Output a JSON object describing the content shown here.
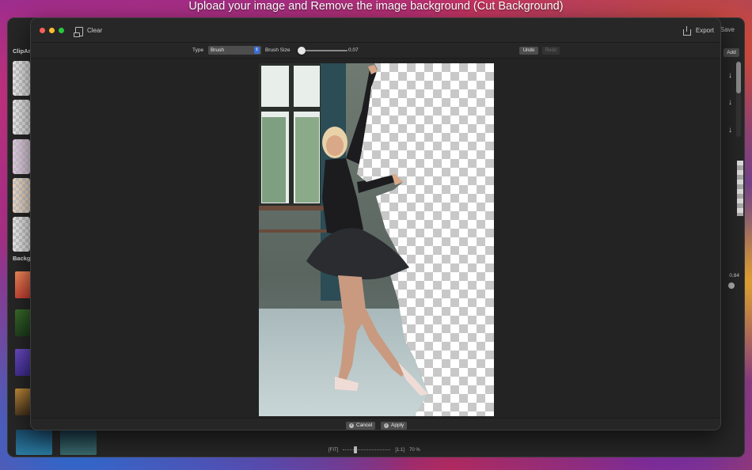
{
  "headline": "Upload your image and Remove the image background (Cut Background)",
  "background_window": {
    "sections": {
      "clipart_label": "ClipArt",
      "background_label": "Backgr"
    },
    "right_panel": {
      "save_label": "Save",
      "add_label": "Add",
      "value_label": "0.84"
    },
    "zoom": {
      "fit_label": "[FIT]",
      "one_to_one_label": "[1:1]",
      "percent_label": "70 %"
    }
  },
  "modal": {
    "titlebar": {
      "clear_label": "Clear",
      "export_label": "Export"
    },
    "toolbar": {
      "type_label": "Type",
      "type_value": "Brush",
      "brush_size_label": "Brush Size",
      "brush_size_value": "0.07",
      "brush_size_fraction": 0.07,
      "undo_label": "Undo",
      "redo_label": "Redo"
    },
    "footer": {
      "cancel_label": "Cancel",
      "apply_label": "Apply"
    }
  },
  "colors": {
    "traffic_red": "#fe5f57",
    "traffic_yellow": "#febc2e",
    "traffic_green": "#28c840",
    "select_accent": "#3d6fd8"
  }
}
